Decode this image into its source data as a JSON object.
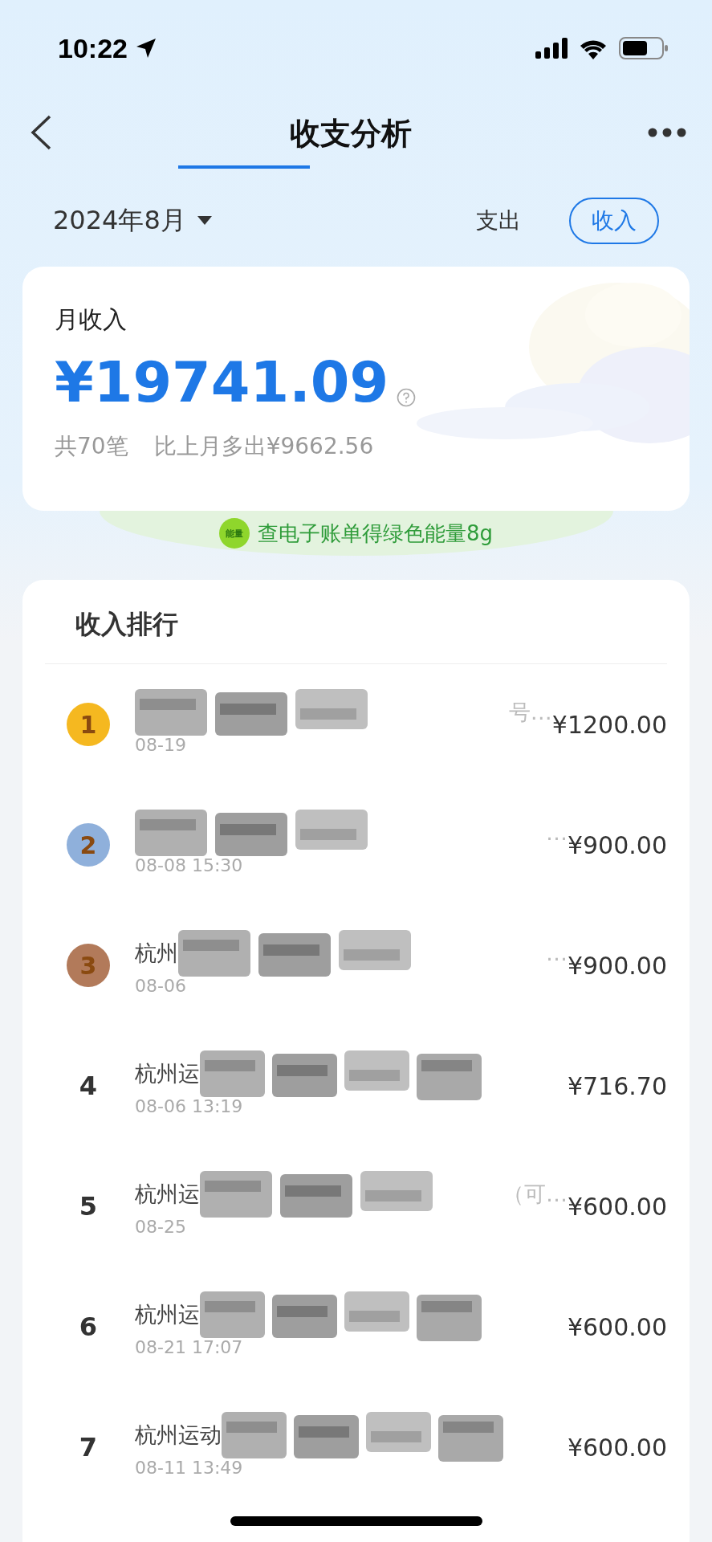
{
  "status_bar": {
    "time": "10:22"
  },
  "nav": {
    "title": "收支分析"
  },
  "filter": {
    "month": "2024年8月",
    "types": [
      {
        "label": "支出",
        "selected": false
      },
      {
        "label": "收入",
        "selected": true
      }
    ]
  },
  "summary": {
    "label": "月收入",
    "amount": "¥19741.09",
    "count": "共70笔",
    "compare": "比上月多出¥9662.56"
  },
  "promo": {
    "badge": "能量",
    "text": "查电子账单得绿色能量8g"
  },
  "ranking": {
    "title": "收入排行",
    "rows": [
      {
        "rank": "1",
        "kind": "medal",
        "color": "#f5b820",
        "name": "",
        "tail": "号…",
        "date": "08-19",
        "amount": "¥1200.00"
      },
      {
        "rank": "2",
        "kind": "medal",
        "color": "#8fb0db",
        "name": "",
        "tail": "…",
        "date": "08-08 15:30",
        "amount": "¥900.00"
      },
      {
        "rank": "3",
        "kind": "medal",
        "color": "#b27a5a",
        "name": "杭州",
        "tail": "…",
        "date": "08-06",
        "amount": "¥900.00"
      },
      {
        "rank": "4",
        "kind": "plain",
        "name": "杭州运",
        "tail": "",
        "date": "08-06 13:19",
        "amount": "¥716.70"
      },
      {
        "rank": "5",
        "kind": "plain",
        "name": "杭州运",
        "tail": "（可…",
        "date": "08-25",
        "amount": "¥600.00"
      },
      {
        "rank": "6",
        "kind": "plain",
        "name": "杭州运",
        "tail": "",
        "date": "08-21 17:07",
        "amount": "¥600.00"
      },
      {
        "rank": "7",
        "kind": "plain",
        "name": "杭州运动",
        "tail": "",
        "date": "08-11 13:49",
        "amount": "¥600.00"
      }
    ]
  }
}
